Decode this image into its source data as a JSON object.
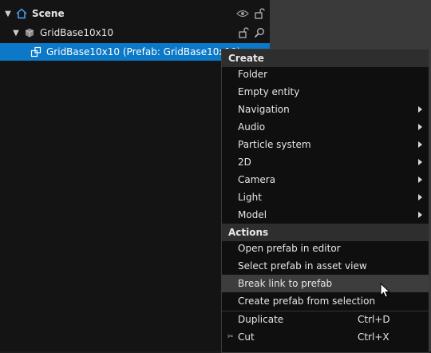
{
  "tree": {
    "scene_label": "Scene",
    "grid_label": "GridBase10x10",
    "prefab_label": "GridBase10x10 (Prefab: GridBase10x10)"
  },
  "menu": {
    "create_header": "Create",
    "create_items": [
      {
        "label": "Folder",
        "submenu": false
      },
      {
        "label": "Empty entity",
        "submenu": false
      },
      {
        "label": "Navigation",
        "submenu": true
      },
      {
        "label": "Audio",
        "submenu": true
      },
      {
        "label": "Particle system",
        "submenu": true
      },
      {
        "label": "2D",
        "submenu": true
      },
      {
        "label": "Camera",
        "submenu": true
      },
      {
        "label": "Light",
        "submenu": true
      },
      {
        "label": "Model",
        "submenu": true
      }
    ],
    "actions_header": "Actions",
    "action_items": [
      {
        "label": "Open prefab in editor"
      },
      {
        "label": "Select prefab in asset view"
      },
      {
        "label": "Break link to prefab"
      },
      {
        "label": "Create prefab from selection"
      }
    ],
    "edit_items": [
      {
        "label": "Duplicate",
        "shortcut": "Ctrl+D"
      },
      {
        "label": "Cut",
        "shortcut": "Ctrl+X"
      }
    ]
  },
  "colors": {
    "selection": "#0b78c8",
    "menu_bg": "#0f0f0f",
    "header_bg": "#2e2e2e",
    "hover_bg": "#3d3d3d"
  }
}
